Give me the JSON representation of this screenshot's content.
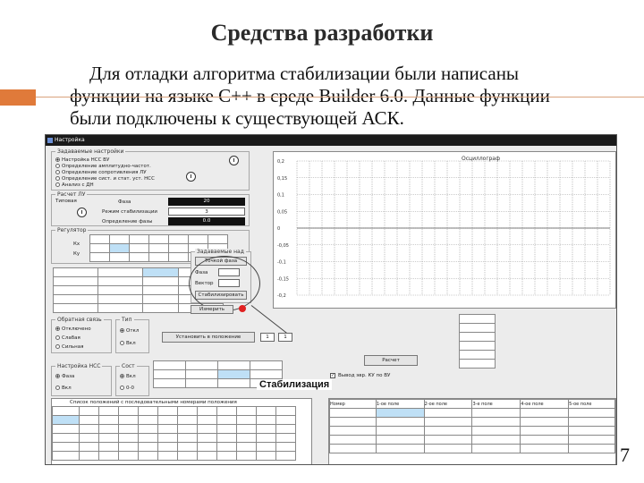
{
  "slide": {
    "title": "Средства разработки",
    "intro_line1": "Для отладки алгоритма стабилизации были написаны",
    "intro_line2": "функции на языке С++ в среде Builder 6.0. Данные функции",
    "intro_line3": "были подключены к существующей АСК.",
    "page_number": "7"
  },
  "app": {
    "window_title": "Настройка",
    "modes_group": {
      "title": "Задаваемые настройки",
      "items": [
        "Настройка НСС ВУ",
        "Определение амплитудно-частот.",
        "Определение сопротивления ЛУ",
        "Определение сист. и стат. уст. НСС",
        "Анализ с ДН"
      ]
    },
    "calc_group": {
      "title": "Расчет ЛУ",
      "sub": "Типовая",
      "fields": [
        {
          "label": "Фаза",
          "value": "20"
        },
        {
          "label": "Режим стабилизации",
          "value": "3"
        },
        {
          "label": "Определение фазы",
          "value": "0.0"
        }
      ]
    },
    "coef_group": {
      "title": "Регулятор",
      "kx": "Кх",
      "ky": "Ку"
    },
    "chart": {
      "title": "Осциллограф",
      "y_ticks": [
        "0,2",
        "0,15",
        "0,1",
        "0,05",
        "0",
        "-0,05",
        "-0,1",
        "-0,15",
        "-0,2"
      ]
    },
    "popup": {
      "title": "Задаваемые над",
      "items": [
        "Точкой фаза",
        "Фаза",
        "Вектор",
        "Стабилизировать"
      ]
    },
    "measure_button": "Измерить",
    "feedback_group": {
      "title": "Обратная связь",
      "options": [
        "Отключено",
        "Слабая",
        "Сильная"
      ]
    },
    "type_group": {
      "title": "Тип",
      "options": [
        "Откл",
        "Вкл"
      ]
    },
    "set_position_button": "Установить в положение",
    "position_values": [
      "1",
      "1"
    ],
    "nss_group": {
      "title": "Настройка НСС",
      "options": [
        "Фаза",
        "Вкл"
      ]
    },
    "sost_group": {
      "title": "Сост",
      "options": [
        "Вкл",
        "0-0"
      ]
    },
    "calc_button": "Расчет",
    "checkbox_label": "Вывод эвр. КУ по ВУ",
    "stab_label": "Стабилизация",
    "bottom_table_header": "Список положений с последовательными номерами положения",
    "result_columns": [
      "Номер",
      "1-ое поле",
      "2-ое поле",
      "3-е поле",
      "4-ое поле",
      "5-ое поле"
    ]
  }
}
